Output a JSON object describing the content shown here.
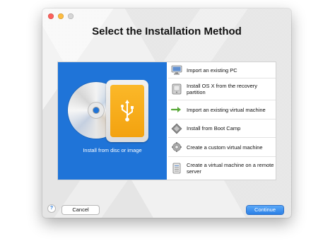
{
  "window": {
    "title": "Select the Installation Method"
  },
  "hero": {
    "label": "Install from disc or image"
  },
  "options": [
    {
      "label": "Import an existing PC",
      "icon": "pc-icon"
    },
    {
      "label": "Install OS X from the recovery partition",
      "icon": "drive-icon"
    },
    {
      "label": "Import an existing virtual machine",
      "icon": "import-arrow-icon"
    },
    {
      "label": "Install from Boot Camp",
      "icon": "boot-camp-icon"
    },
    {
      "label": "Create a custom virtual machine",
      "icon": "gear-icon"
    },
    {
      "label": "Create a virtual machine on a remote server",
      "icon": "server-icon"
    }
  ],
  "footer": {
    "help_label": "?",
    "cancel_label": "Cancel",
    "continue_label": "Continue"
  },
  "colors": {
    "accent": "#1f74d8",
    "usb_orange": "#f3a20f"
  }
}
